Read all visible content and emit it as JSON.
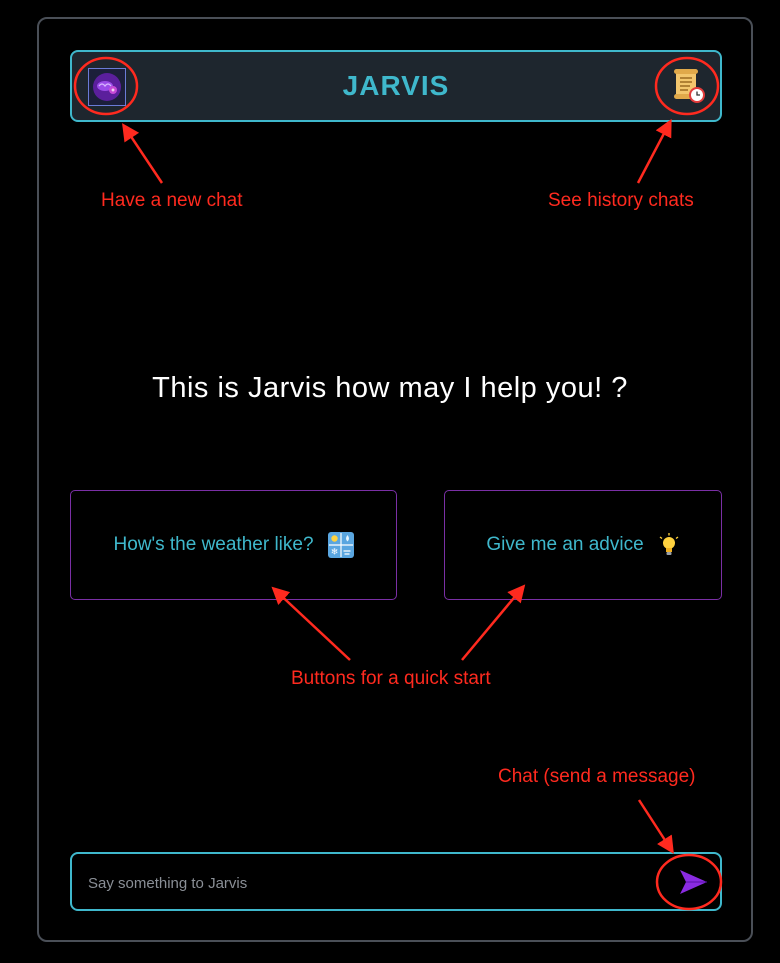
{
  "header": {
    "title": "JARVIS",
    "new_chat_icon": "brain-chat-icon",
    "history_icon": "scroll-clock-icon"
  },
  "main": {
    "greeting": "This is Jarvis how may I help you! ?",
    "quick_buttons": [
      {
        "label": "How's the weather like?",
        "icon": "weather-icon"
      },
      {
        "label": "Give me an advice",
        "icon": "lightbulb-icon"
      }
    ]
  },
  "chat": {
    "placeholder": "Say something to Jarvis",
    "value": "",
    "send_icon": "send-arrow-icon"
  },
  "annotations": {
    "new_chat": "Have a new chat",
    "history": "See history chats",
    "quick_start": "Buttons for a quick start",
    "send": "Chat (send a message)"
  },
  "colors": {
    "accent": "#3fb8cc",
    "annotation": "#ff2a1f",
    "quick_border": "#7a2fa5",
    "send": "#8a2be2"
  }
}
